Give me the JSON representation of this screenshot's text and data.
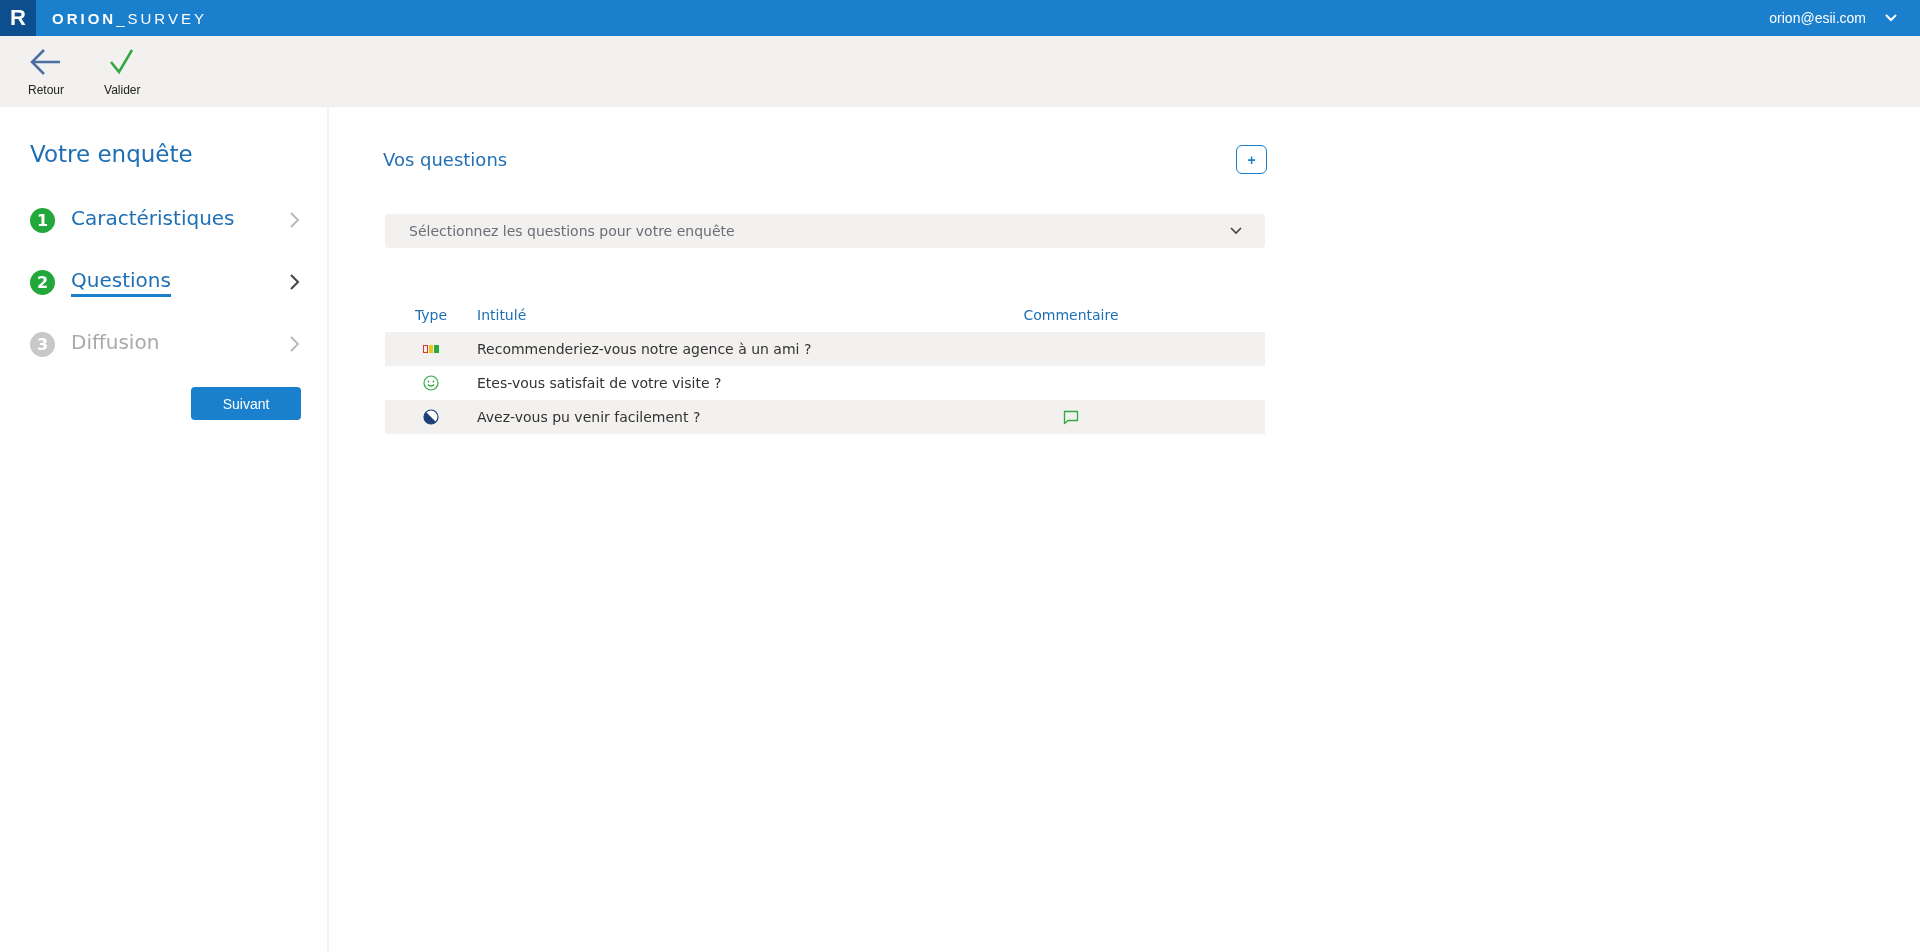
{
  "app": {
    "logo_letter": "R",
    "brand": "**ORION**_SURVEY",
    "user": "orion@esii.com"
  },
  "toolbar": [
    {
      "kind": "back",
      "label": "Retour"
    },
    {
      "kind": "validate",
      "label": "Valider"
    }
  ],
  "sidebar": {
    "title": "Votre enquête",
    "steps": [
      {
        "number": "1",
        "label": "Caractéristiques",
        "disabled": false,
        "selected": false
      },
      {
        "number": "2",
        "label": "Questions",
        "disabled": false,
        "selected": true
      },
      {
        "number": "3",
        "label": "Diffusion",
        "disabled": true,
        "selected": false
      }
    ],
    "next_button": "Suivant"
  },
  "main": {
    "title": "Vos questions",
    "add_button": "+",
    "select": {
      "placeholder": "Sélectionnez les questions pour votre enquête"
    },
    "table": {
      "columns": [
        "Type",
        "Intitulé",
        "Commentaire"
      ],
      "rows": [
        {
          "kind": "rating",
          "label": "Recommenderiez-vous notre agence à un ami ?",
          "comment": false
        },
        {
          "kind": "smiley",
          "label": "Etes-vous satisfait de votre visite ?",
          "comment": false
        },
        {
          "kind": "yesno",
          "label": "Avez-vous pu venir facilement ?",
          "comment": true
        }
      ]
    }
  }
}
